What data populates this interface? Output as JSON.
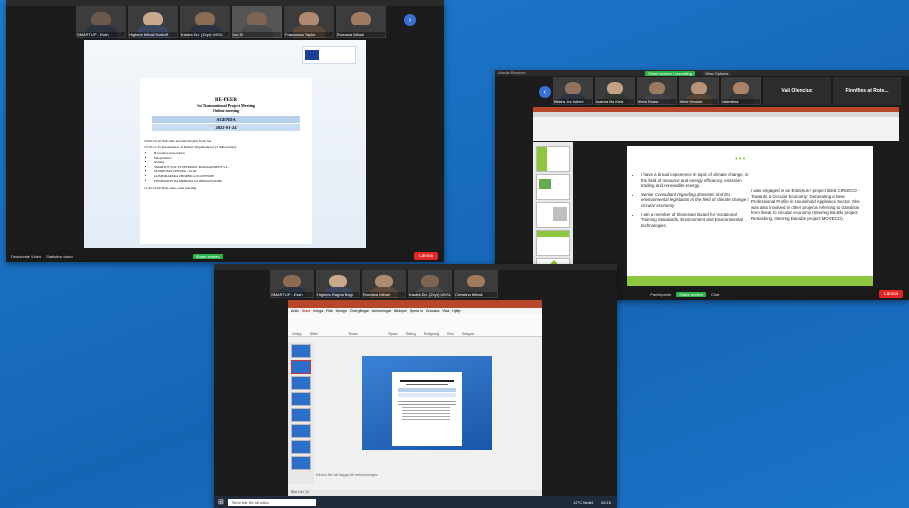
{
  "screen1": {
    "participants": [
      "SMARTUP - Ewin",
      "Highers Mihail Kostoff",
      "Kastra Du. (Zvyr) UKSL",
      "Ivo Si",
      "Francesca Taylor",
      "Romana Mihail"
    ],
    "doc": {
      "title_line1": "RE-PEER",
      "title_line2": "1st Transnational Project Meeting",
      "title_line3": "Online meeting",
      "agenda": "AGENDA",
      "date": "2022-01-24",
      "line1": "10.00-10.10 Welcome and information from SA",
      "line2": "10.10-11.45 Presentation of Partner Organizations (5 min/partner)",
      "bullets": [
        "B-Creative Association",
        "Peloponnisos",
        "Nafsika",
        "SMARTUP VOL SYSTEMATIC MANAGEMENT S.L.",
        "OLIMPIJSKI CENTAR - ALAT",
        "GOSPODARSKA ZBORNICA SLOVENIJE",
        "FONDATION NA MERIDIA ZA OBRAZOVANIE"
      ],
      "line3": "11.45-12.00 Next steps, next meeting"
    },
    "bottom": {
      "left1": "Deactivate Video",
      "left2": "Statistics video",
      "center": "Share screen",
      "end": "Lämna"
    }
  },
  "screen2": {
    "title": "Ursula Reunion",
    "top_chip1": "Share screen / recording",
    "top_chip2": "View Options",
    "participants": [
      "Bilstra Jnr Islemi",
      "Ioanna Ba Kela",
      "Iñeta Ruaw",
      "Mike Heuser",
      "Valentina"
    ],
    "names_right": [
      "Vali Olenciuc",
      "Finnflies at Rote..."
    ],
    "slide": {
      "left_bullets": [
        "I have a broad experience in topic of climate change, in the field of resource and energy efficiency, emission trading and renewable energy.",
        "Senior Consultant regarding domestic and EU environmental legislation in the field of climate change / circular economy.",
        "I am a member of Slovenian Board for Vocational Training Standards, Environment and Environmental technologies."
      ],
      "right_text": "I was engaged in an Erasmus+ project titled CIRcECO - Towards a Circular Economy: Generating a New Professional Profile in Household Appliance Sector. She was also involved in other projects referring to transition from linear to circular economy (Interreg Ba-Blo project Retracking, Interreg Danube project MOVECO)."
    },
    "bottom": {
      "left": "Deactivate Video",
      "participants": "Participants",
      "share": "Share screen",
      "chat": "Chat",
      "end": "Lämna"
    }
  },
  "screen3": {
    "participants": [
      "SMARTUP - Ewin",
      "Highers Ragna Bogi",
      "Romana Mihail",
      "Kastra Du. (Zvyr) UKSL",
      "Christina Mihail"
    ],
    "ribbon_tabs": [
      "Arkiv",
      "Start",
      "Infoga",
      "Rita",
      "Design",
      "Övergångar",
      "Animeringar",
      "Bildspel",
      "Spela in",
      "Granska",
      "Visa",
      "Hjälp"
    ],
    "ribbon_groups": [
      "Urklipp",
      "Bilder",
      "Tecken",
      "Stycke",
      "Ritning",
      "Redigering",
      "Röst",
      "Designer"
    ],
    "notes_placeholder": "Klicka för att lägga till anteckningar",
    "status": "Bild 2 av 13",
    "taskbar": {
      "search": "Skriv här för att söka",
      "weather": "12°C Mulet",
      "time": "20:15"
    }
  }
}
